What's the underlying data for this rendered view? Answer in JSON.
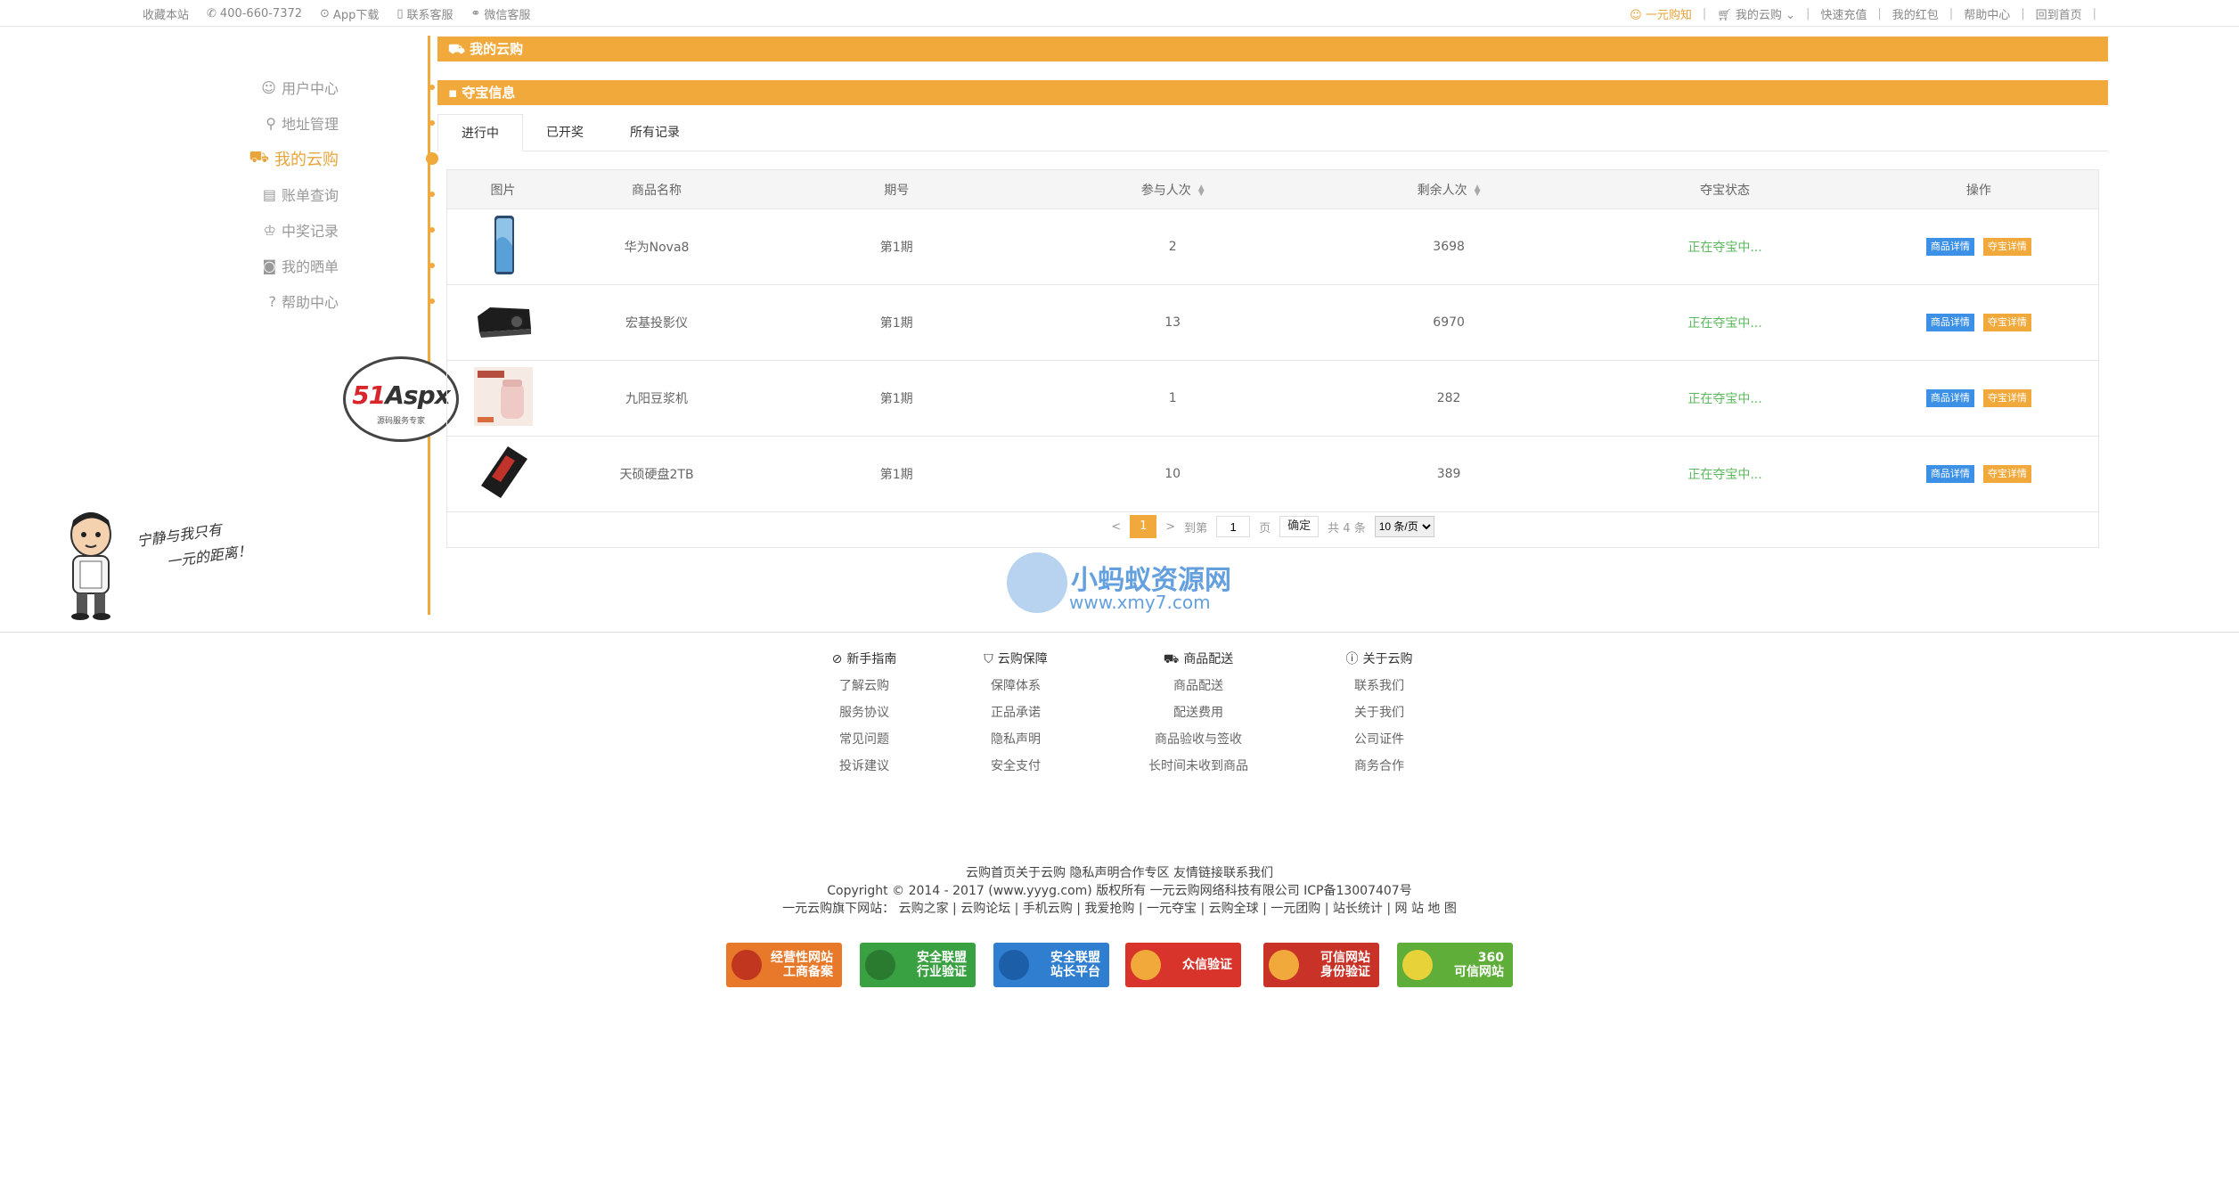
{
  "topbar": {
    "left": [
      "收藏本站",
      "400-660-7372",
      "App下载",
      "联系客服",
      "微信客服"
    ],
    "right": [
      "一元购知",
      "我的云购",
      "快速充值",
      "我的红包",
      "帮助中心",
      "回到首页"
    ]
  },
  "sidebar": {
    "items": [
      {
        "label": "用户中心",
        "icon": "user-icon"
      },
      {
        "label": "地址管理",
        "icon": "location-icon"
      },
      {
        "label": "我的云购",
        "icon": "cart-icon"
      },
      {
        "label": "账单查询",
        "icon": "bill-icon"
      },
      {
        "label": "中奖记录",
        "icon": "award-icon"
      },
      {
        "label": "我的晒单",
        "icon": "camera-icon"
      },
      {
        "label": "帮助中心",
        "icon": "help-icon"
      }
    ],
    "active_index": 2
  },
  "logo51": {
    "text_red": "51",
    "text": "Aspx",
    "sub": "源码服务专家"
  },
  "cartoon": {
    "line1": "宁静与我只有",
    "line2": "一元的距离！"
  },
  "main": {
    "bar1": "我的云购",
    "bar2": "夺宝信息",
    "tabs": [
      "进行中",
      "已开奖",
      "所有记录"
    ],
    "headers": [
      "图片",
      "商品名称",
      "期号",
      "参与人次",
      "剩余人次",
      "夺宝状态",
      "操作"
    ],
    "rows": [
      {
        "name": "华为Nova8",
        "period": "第1期",
        "joined": "2",
        "remaining": "3698",
        "status": "正在夺宝中...",
        "thumb": "phone"
      },
      {
        "name": "宏基投影仪",
        "period": "第1期",
        "joined": "13",
        "remaining": "6970",
        "status": "正在夺宝中...",
        "thumb": "projector"
      },
      {
        "name": "九阳豆浆机",
        "period": "第1期",
        "joined": "1",
        "remaining": "282",
        "status": "正在夺宝中...",
        "thumb": "soymilk"
      },
      {
        "name": "天硕硬盘2TB",
        "period": "第1期",
        "joined": "10",
        "remaining": "389",
        "status": "正在夺宝中...",
        "thumb": "ssd"
      }
    ],
    "btn_detail": "商品详情",
    "btn_treasure": "夺宝详情"
  },
  "pager": {
    "prev": "<",
    "current": "1",
    "next": ">",
    "goto_label": "到第",
    "goto_value": "1",
    "page_unit": "页",
    "confirm": "确定",
    "total": "共 4 条",
    "per_page": "10 条/页"
  },
  "watermark": {
    "title": "小蚂蚁资源网",
    "url": "www.xmy7.com"
  },
  "footer": {
    "cols": [
      {
        "title": "新手指南",
        "icon": "compass-icon",
        "links": [
          "了解云购",
          "服务协议",
          "常见问题",
          "投诉建议"
        ]
      },
      {
        "title": "云购保障",
        "icon": "shield-icon",
        "links": [
          "保障体系",
          "正品承诺",
          "隐私声明",
          "安全支付"
        ]
      },
      {
        "title": "商品配送",
        "icon": "truck-icon",
        "links": [
          "商品配送",
          "配送费用",
          "商品验收与签收",
          "长时间未收到商品"
        ]
      },
      {
        "title": "关于云购",
        "icon": "info-icon",
        "links": [
          "联系我们",
          "关于我们",
          "公司证件",
          "商务合作"
        ]
      }
    ],
    "line1": "云购首页关于云购 隐私声明合作专区 友情链接联系我们",
    "line2": "Copyright © 2014 - 2017 (www.yyyg.com) 版权所有 一元云购网络科技有限公司 ICP备13007407号",
    "line3": "一元云购旗下网站： 云购之家 | 云购论坛 | 手机云购 | 我爱抢购 | 一元夺宝 | 云购全球 | 一元团购 | 站长统计 | 网 站 地 图",
    "badges": [
      {
        "text": "经营性网站\n工商备案",
        "color": "#e8792a"
      },
      {
        "text": "安全联盟\n行业验证",
        "color": "#3aa142"
      },
      {
        "text": "安全联盟\n站长平台",
        "color": "#2f7ecf"
      },
      {
        "text": "众信验证",
        "color": "#d9342b"
      },
      {
        "text": "可信网站\n身份验证",
        "color": "#c93227"
      },
      {
        "text": "360\n可信网站",
        "color": "#5fae3a"
      }
    ]
  }
}
